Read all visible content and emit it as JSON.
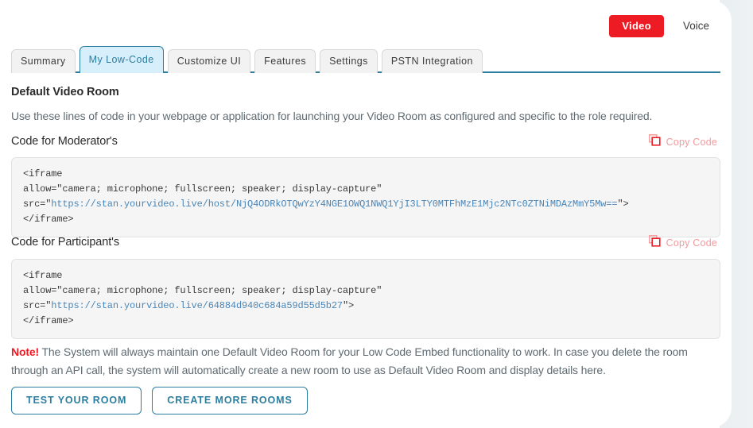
{
  "header": {
    "video_label": "Video",
    "voice_label": "Voice",
    "video_color": "#ed1c24"
  },
  "tabs": [
    {
      "label": "Summary",
      "active": false
    },
    {
      "label": "My Low-Code",
      "active": true
    },
    {
      "label": "Customize UI",
      "active": false
    },
    {
      "label": "Features",
      "active": false
    },
    {
      "label": "Settings",
      "active": false
    },
    {
      "label": "PSTN Integration",
      "active": false
    }
  ],
  "main": {
    "section_title": "Default Video Room",
    "section_desc": "Use these lines of code in your webpage or application for launching your Video Room as configured and specific to the role required.",
    "moderator": {
      "label": "Code for Moderator's",
      "copy_label": "Copy Code",
      "line1": "<iframe",
      "line2": "allow=\"camera; microphone; fullscreen; speaker; display-capture\"",
      "line3_prefix": "src=\"",
      "line3_url": "https://stan.yourvideo.live/host/NjQ4ODRkOTQwYzY4NGE1OWQ1NWQ1YjI3LTY0MTFhMzE1Mjc2NTc0ZTNiMDAzMmY5Mw==",
      "line3_suffix": "\">",
      "line4": "</iframe>"
    },
    "participant": {
      "label": "Code for Participant's",
      "copy_label": "Copy Code",
      "line1": "<iframe",
      "line2": "allow=\"camera; microphone; fullscreen; speaker; display-capture\"",
      "line3_prefix": "src=\"",
      "line3_url": "https://stan.yourvideo.live/64884d940c684a59d55d5b27",
      "line3_suffix": "\">",
      "line4": "</iframe>"
    },
    "note": {
      "tag": "Note!",
      "text": " The System will always maintain one Default Video Room for your Low Code Embed functionality to work. In case you delete the room through an API call, the system will automatically create a new room to use as Default Video Room and display details here."
    },
    "actions": {
      "test_room_label": "TEST YOUR ROOM",
      "create_rooms_label": "CREATE MORE ROOMS"
    }
  }
}
